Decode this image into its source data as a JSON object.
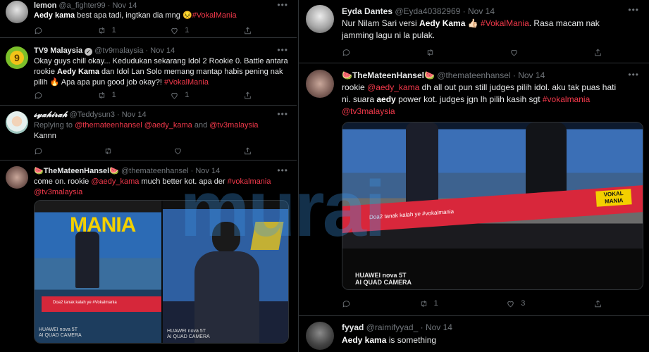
{
  "left": {
    "t1": {
      "name": "lemon",
      "handle": "@a_fighter99",
      "dot": "·",
      "date": "Nov 14",
      "text": "best apa tadi, ingtkan dia mng",
      "mention": "Aedy kama",
      "emoji": "😣",
      "tag": "#VokalMania",
      "replies": "",
      "retweets": "1",
      "likes": "1"
    },
    "t2": {
      "name": "TV9 Malaysia",
      "handle": "@tv9malaysia",
      "dot": "·",
      "date": "Nov 14",
      "line1": "Okay guys chill okay... Kedudukan sekarang Idol 2 Rookie 0. Battle antara",
      "line2a": "rookie",
      "line2b": "Aedy Kama",
      "line2c": "dan Idol Lan Solo memang mantap habis pening nak",
      "line3a": "pilih",
      "line3b": "🔥",
      "line3c": "Apa apa pun good job okay?!",
      "tag": "#VokalMania",
      "replies": "",
      "retweets": "1",
      "likes": "1"
    },
    "t3": {
      "name": "𝓼𝔂𝓪𝓱𝓲𝓻𝓪𝓱",
      "handle": "@Teddysun3",
      "dot": "·",
      "date": "Nov 14",
      "replying": "Replying to",
      "r1": "@themateenhansel",
      "r2": "@aedy_kama",
      "and": "and",
      "r3": "@tv3malaysia",
      "text": "Kannn"
    },
    "t4": {
      "name_pre": "🍉",
      "name": "TheMateenHansel",
      "name_post": "🍉",
      "handle": "@thematееnhansel",
      "dot": "·",
      "date": "Nov 14",
      "text1": "come on. rookie",
      "mention": "@aedy_kama",
      "text2": "much better kot. apa der",
      "tag": "#vokalmania",
      "tag2": "@tv3malaysia",
      "m1_caption": "Doa2 tanak kalah ye #Vokalmania",
      "m1_logo": "MANIA",
      "m2_caption": "HUAWEI nova 5T",
      "m2_caption2": "AI QUAD CAMERA",
      "m1_cam": "HUAWEI nova 5T",
      "m1_cam2": "AI QUAD CAMERA"
    }
  },
  "right": {
    "t5": {
      "name": "Eyda Dantes",
      "handle": "@Eyda40382969",
      "dot": "·",
      "date": "Nov 14",
      "text1": "Nur Nilam Sari versi",
      "mention": "Aedy Kama",
      "emoji": "👍🏻",
      "tag": "#VokalMania",
      "text2": ".  Rasa macam nak",
      "line2": "jamming lagu ni la pulak."
    },
    "t6": {
      "name_pre": "🍉",
      "name": "TheMateenHansel",
      "name_post": "🍉",
      "handle": "@themateenhansel",
      "dot": "·",
      "date": "Nov 14",
      "l1a": "rookie",
      "l1b": "@aedy_kama",
      "l1c": "dh all out pun still judges pilih idol. aku tak puas hati",
      "l2a": "ni. suara",
      "l2b": "aedy",
      "l2c": "power kot. judges jgn lh pilih kasih sgt",
      "l2d": "#vokalmania",
      "l3": "@tv3malaysia",
      "media_caption": "Doa2 tanak kalah ye #vokalmania",
      "media_logo": "VOKAL MANIA",
      "cam1": "HUAWEI nova 5T",
      "cam2": "AI QUAD CAMERA",
      "replies": "",
      "retweets": "1",
      "likes": "3"
    },
    "t7": {
      "name": "fyyad",
      "handle": "@raimifyyad_",
      "dot": "·",
      "date": "Nov 14",
      "mention": "Aedy kama",
      "text": "is something"
    }
  },
  "watermark": "murai",
  "icons": [
    "reply-icon",
    "retweet-icon",
    "like-icon",
    "share-icon",
    "more-icon",
    "verified-icon"
  ],
  "colors": {
    "background": "#000000",
    "hashtag": "#f3394b",
    "link": "#1d9bf0",
    "muted": "#71767b"
  }
}
